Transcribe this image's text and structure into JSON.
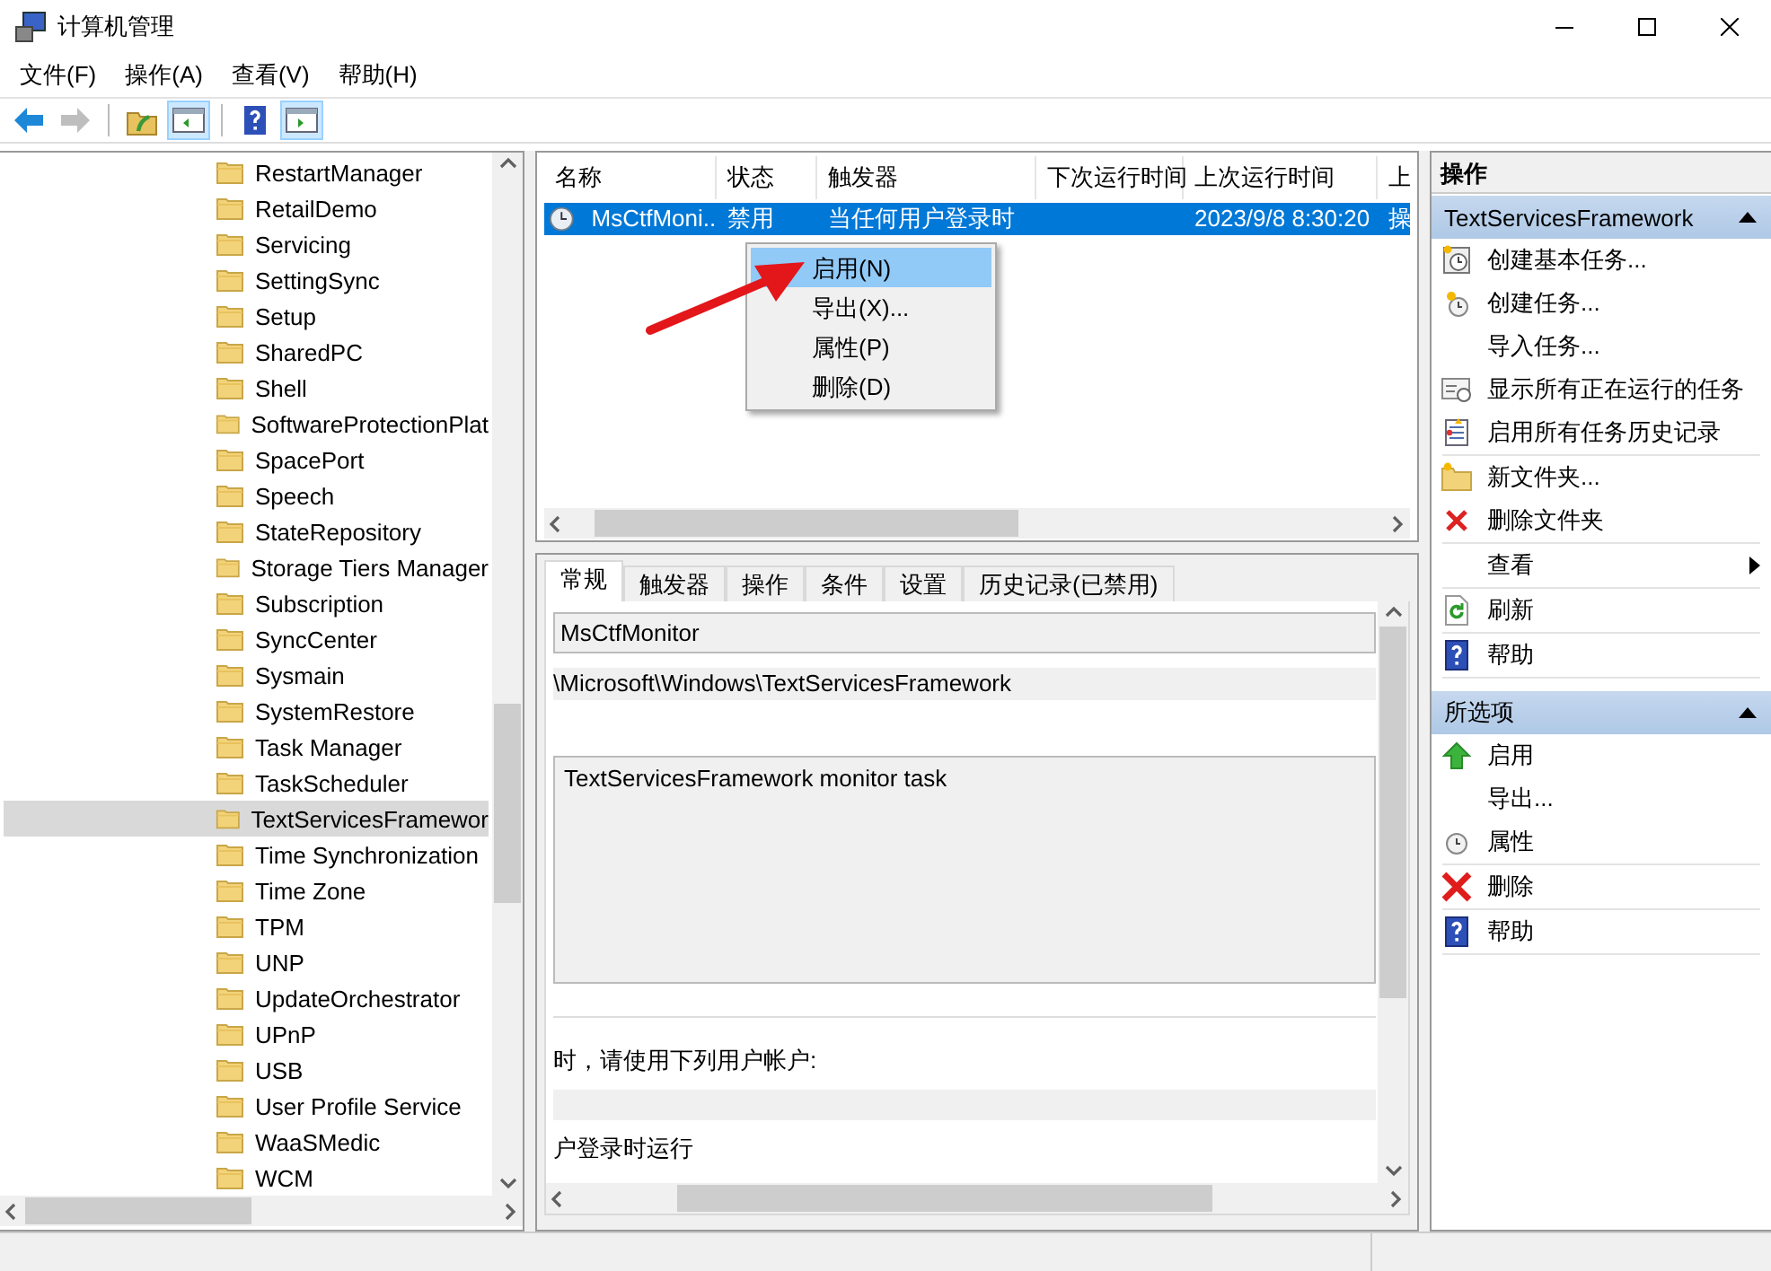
{
  "window": {
    "title": "计算机管理"
  },
  "menu": [
    "文件(F)",
    "操作(A)",
    "查看(V)",
    "帮助(H)"
  ],
  "toolbar": [
    {
      "kind": "back",
      "pressed": false,
      "disabled": false
    },
    {
      "kind": "forward",
      "pressed": false,
      "disabled": true
    },
    {
      "kind": "up",
      "pressed": false,
      "disabled": false
    },
    {
      "kind": "tree",
      "pressed": true,
      "disabled": false
    },
    {
      "kind": "help",
      "pressed": false,
      "disabled": false
    },
    {
      "kind": "pane",
      "pressed": true,
      "disabled": false
    }
  ],
  "tree": {
    "items": [
      {
        "label": "RestartManager",
        "selected": false
      },
      {
        "label": "RetailDemo",
        "selected": false
      },
      {
        "label": "Servicing",
        "selected": false
      },
      {
        "label": "SettingSync",
        "selected": false
      },
      {
        "label": "Setup",
        "selected": false
      },
      {
        "label": "SharedPC",
        "selected": false
      },
      {
        "label": "Shell",
        "selected": false
      },
      {
        "label": "SoftwareProtectionPlat",
        "selected": false
      },
      {
        "label": "SpacePort",
        "selected": false
      },
      {
        "label": "Speech",
        "selected": false
      },
      {
        "label": "StateRepository",
        "selected": false
      },
      {
        "label": "Storage Tiers Manager",
        "selected": false
      },
      {
        "label": "Subscription",
        "selected": false
      },
      {
        "label": "SyncCenter",
        "selected": false
      },
      {
        "label": "Sysmain",
        "selected": false
      },
      {
        "label": "SystemRestore",
        "selected": false
      },
      {
        "label": "Task Manager",
        "selected": false
      },
      {
        "label": "TaskScheduler",
        "selected": false
      },
      {
        "label": "TextServicesFramewor",
        "selected": true
      },
      {
        "label": "Time Synchronization",
        "selected": false
      },
      {
        "label": "Time Zone",
        "selected": false
      },
      {
        "label": "TPM",
        "selected": false
      },
      {
        "label": "UNP",
        "selected": false
      },
      {
        "label": "UpdateOrchestrator",
        "selected": false
      },
      {
        "label": "UPnP",
        "selected": false
      },
      {
        "label": "USB",
        "selected": false
      },
      {
        "label": "User Profile Service",
        "selected": false
      },
      {
        "label": "WaaSMedic",
        "selected": false
      },
      {
        "label": "WCM",
        "selected": false
      }
    ]
  },
  "task_list": {
    "columns": [
      "名称",
      "状态",
      "触发器",
      "下次运行时间",
      "上次运行时间",
      "上"
    ],
    "rows": [
      {
        "name": "MsCtfMoni...",
        "status": "禁用",
        "trigger": "当任何用户登录时",
        "last_run": "2023/9/8 8:30:20",
        "column_6": "操",
        "selected": true
      }
    ]
  },
  "context_menu": {
    "items": [
      {
        "label": "启用(N)",
        "selected": true
      },
      {
        "label": "导出(X)...",
        "selected": false
      },
      {
        "label": "属性(P)",
        "selected": false
      },
      {
        "label": "删除(D)",
        "selected": false
      }
    ]
  },
  "details": {
    "tabs": [
      {
        "label": "常规",
        "selected": true
      },
      {
        "label": "触发器",
        "selected": false
      },
      {
        "label": "操作",
        "selected": false
      },
      {
        "label": "条件",
        "selected": false
      },
      {
        "label": "设置",
        "selected": false
      },
      {
        "label": "历史记录(已禁用)",
        "selected": false
      }
    ],
    "name": "MsCtfMonitor",
    "location": "\\Microsoft\\Windows\\TextServicesFramework",
    "description": "TextServicesFramework monitor task",
    "account_prompt": "时，请使用下列用户帐户:",
    "run_option": "户登录时运行"
  },
  "actions": {
    "header": "操作",
    "sections": [
      {
        "title": "TextServicesFramework",
        "expanded": true,
        "groups": [
          [
            {
              "label": "创建基本任务...",
              "kind": "basic-task"
            },
            {
              "label": "创建任务...",
              "kind": "task"
            },
            {
              "label": "导入任务...",
              "kind": "plain"
            },
            {
              "label": "显示所有正在运行的任务",
              "kind": "running"
            },
            {
              "label": "启用所有任务历史记录",
              "kind": "history"
            }
          ],
          [
            {
              "label": "新文件夹...",
              "kind": "folder"
            },
            {
              "label": "删除文件夹",
              "kind": "delete"
            }
          ],
          [
            {
              "label": "查看",
              "kind": "submenu"
            }
          ],
          [
            {
              "label": "刷新",
              "kind": "refresh"
            }
          ],
          [
            {
              "label": "帮助",
              "kind": "help"
            }
          ]
        ]
      },
      {
        "title": "所选项",
        "expanded": true,
        "groups": [
          [
            {
              "label": "启用",
              "kind": "enable"
            },
            {
              "label": "导出...",
              "kind": "plain"
            },
            {
              "label": "属性",
              "kind": "clock"
            }
          ],
          [
            {
              "label": "删除",
              "kind": "delete-big"
            }
          ],
          [
            {
              "label": "帮助",
              "kind": "help"
            }
          ]
        ]
      }
    ]
  }
}
